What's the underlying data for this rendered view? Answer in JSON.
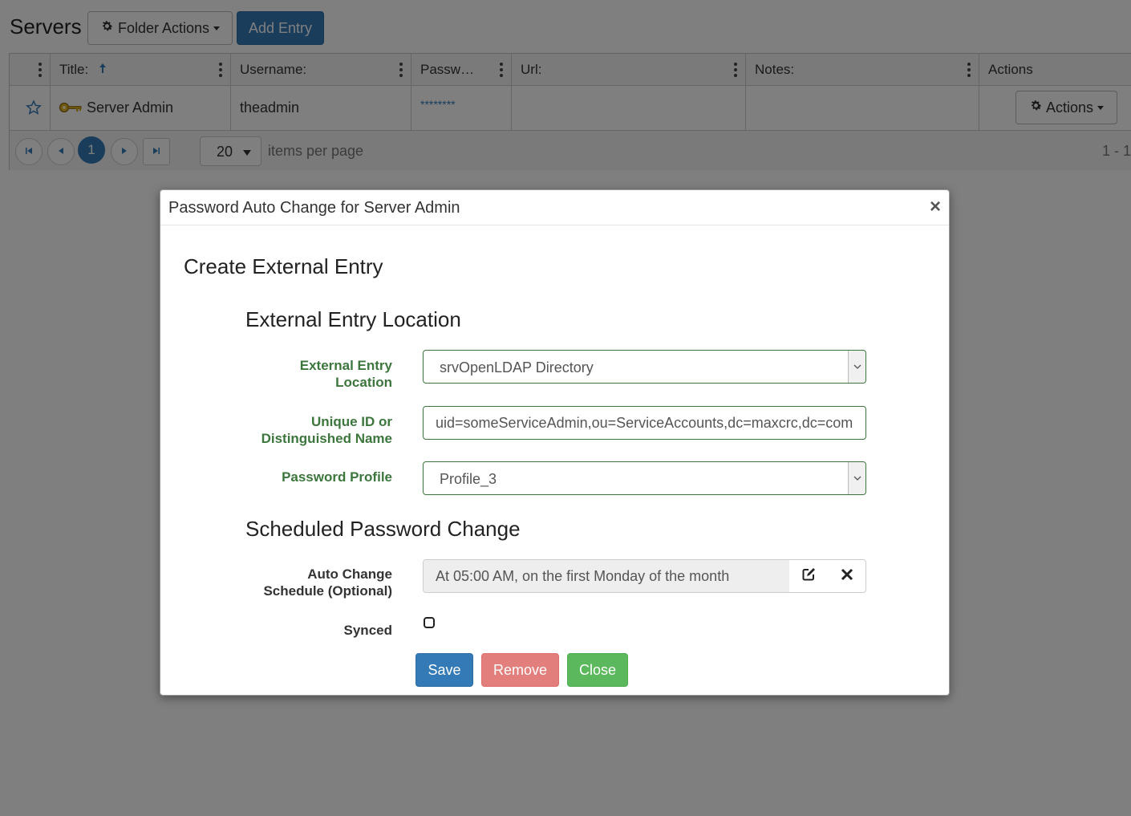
{
  "header": {
    "title": "Servers",
    "folder_actions_label": "Folder Actions",
    "add_entry_label": "Add Entry"
  },
  "grid": {
    "columns": [
      "",
      "Title:",
      "Username:",
      "Passw…",
      "Url:",
      "Notes:",
      "Actions"
    ],
    "rows": [
      {
        "title": "Server Admin",
        "username": "theadmin",
        "password": "********",
        "url": "",
        "notes": "",
        "actions_label": "Actions"
      }
    ],
    "pager": {
      "current_page": "1",
      "per_page": "20",
      "per_page_label": "items per page",
      "range": "1 - 1"
    }
  },
  "modal": {
    "title": "Password Auto Change for Server Admin",
    "close_glyph": "×",
    "heading": "Create External Entry",
    "section_location": "External Entry Location",
    "fields": {
      "location_label": "External Entry Location",
      "location_value": "srvOpenLDAP Directory",
      "dn_label": "Unique ID or Distinguished Name",
      "dn_value": "uid=someServiceAdmin,ou=ServiceAccounts,dc=maxcrc,dc=com",
      "profile_label": "Password Profile",
      "profile_value": "Profile_3"
    },
    "section_schedule": "Scheduled Password Change",
    "schedule": {
      "label": "Auto Change Schedule (Optional)",
      "value": "At 05:00 AM, on the first Monday of the month"
    },
    "synced": {
      "label": "Synced",
      "checked": false
    },
    "buttons": {
      "save": "Save",
      "remove": "Remove",
      "close": "Close"
    }
  },
  "colors": {
    "primary": "#337ab7",
    "danger": "#d9534f",
    "success": "#5cb85c",
    "label_green": "#3c763d"
  },
  "icons": [
    "gear-icon",
    "sort-up-arrow-icon",
    "kebab-menu-icon",
    "star-icon",
    "key-icon",
    "first-page-icon",
    "prev-page-icon",
    "next-page-icon",
    "last-page-icon",
    "edit-icon",
    "clear-icon",
    "close-icon"
  ]
}
